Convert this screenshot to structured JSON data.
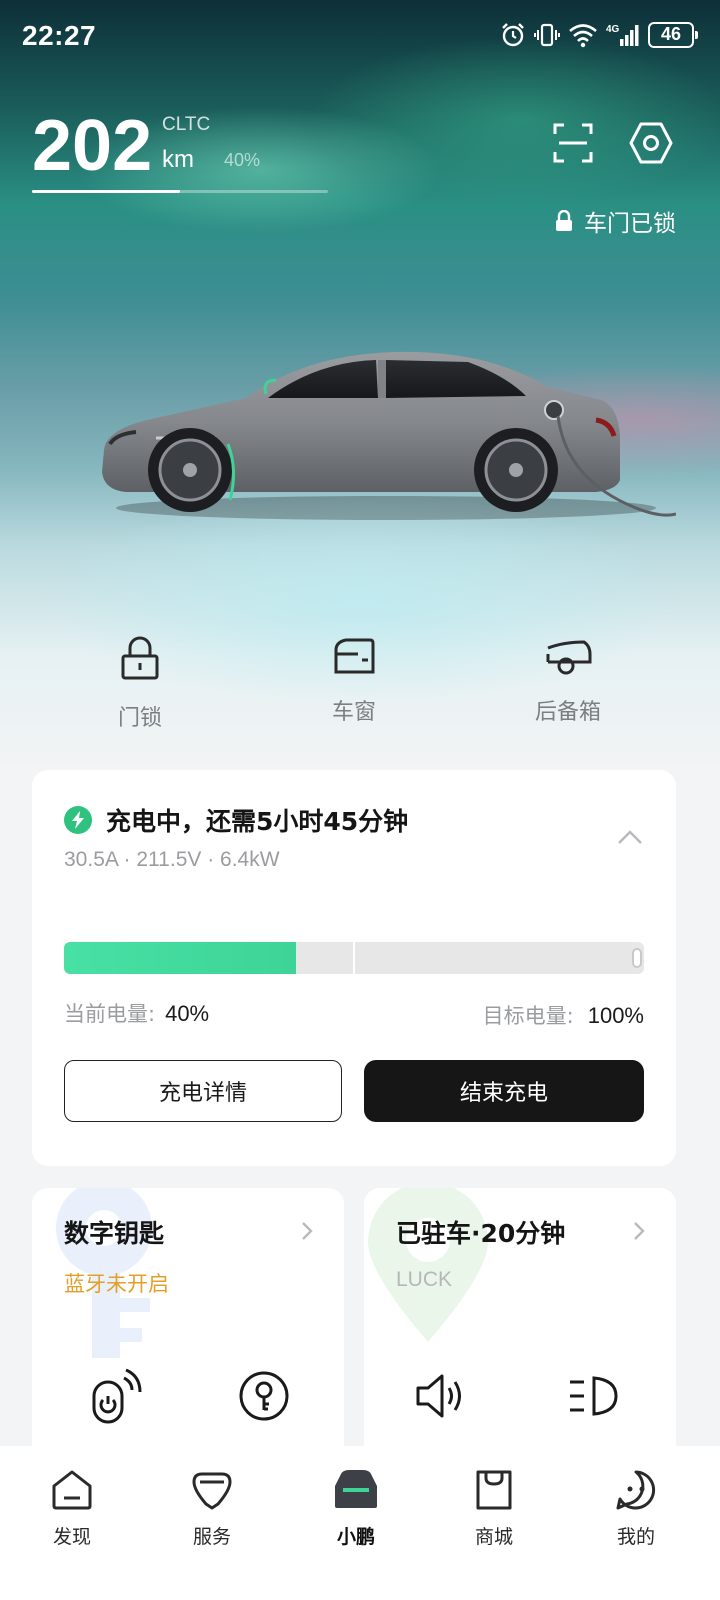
{
  "status_bar": {
    "time": "22:27",
    "battery": "46"
  },
  "vehicle": {
    "range_value": "202",
    "range_standard": "CLTC",
    "range_unit": "km",
    "battery_percent_label": "40%",
    "range_bar_fraction": 0.5,
    "door_status": "车门已锁"
  },
  "quick_controls": [
    {
      "label": "门锁",
      "icon": "lock-icon"
    },
    {
      "label": "车窗",
      "icon": "window-icon"
    },
    {
      "label": "后备箱",
      "icon": "trunk-icon"
    }
  ],
  "charging": {
    "title": "充电中，还需5小时45分钟",
    "specs": "30.5A · 211.5V · 6.4kW",
    "current_label": "当前电量:",
    "current_value": "40%",
    "target_label": "目标电量:",
    "target_value": "100%",
    "progress_fraction": 0.4,
    "detail_button": "充电详情",
    "stop_button": "结束充电",
    "accent_color": "#2fc27e"
  },
  "digital_key": {
    "title": "数字钥匙",
    "status": "蓝牙未开启",
    "status_color": "#e3a028"
  },
  "parking": {
    "title": "已驻车·20分钟",
    "location": "LUCK"
  },
  "bottom_nav": [
    {
      "label": "发现",
      "icon": "discover-icon"
    },
    {
      "label": "服务",
      "icon": "service-icon"
    },
    {
      "label": "小鹏",
      "icon": "car-icon",
      "active": true
    },
    {
      "label": "商城",
      "icon": "shop-icon"
    },
    {
      "label": "我的",
      "icon": "profile-icon"
    }
  ]
}
